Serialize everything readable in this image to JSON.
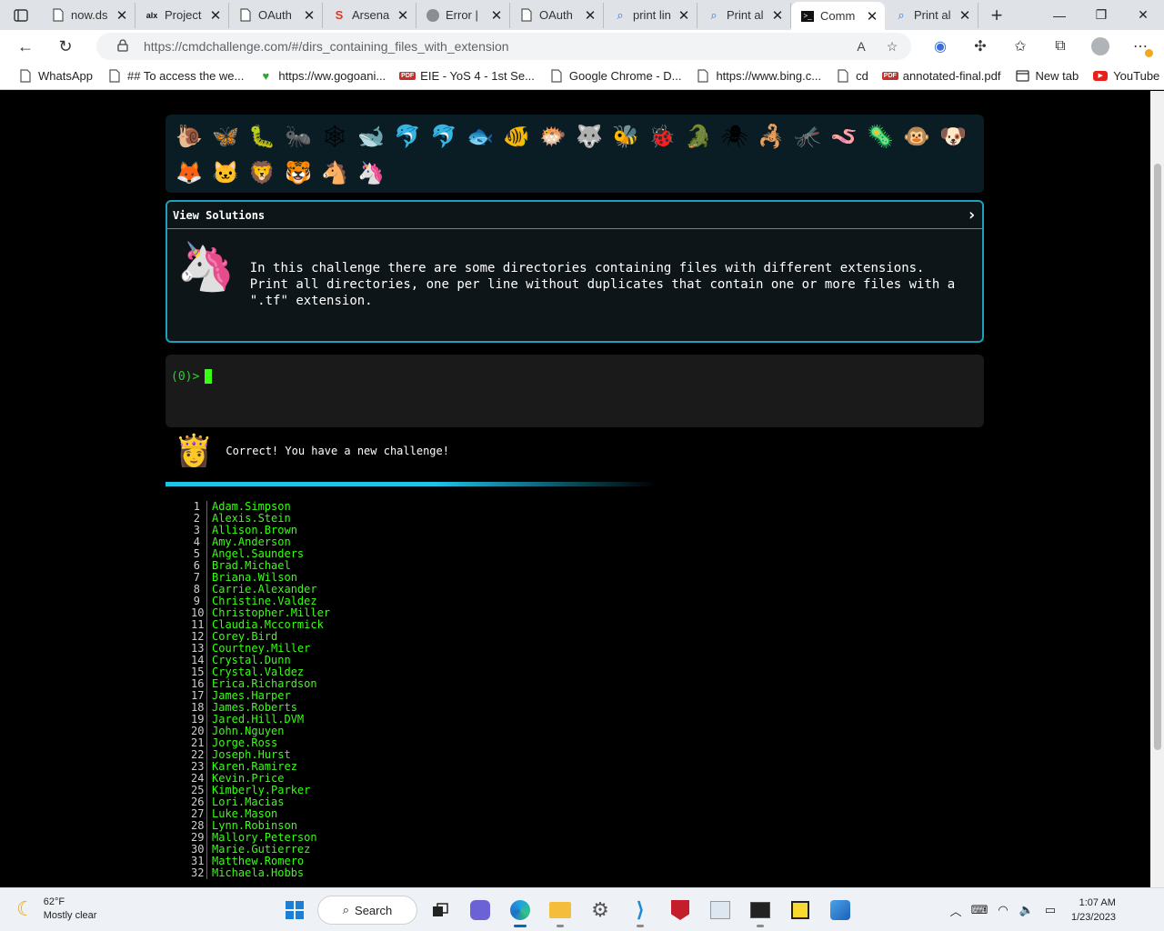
{
  "browser": {
    "tabs": [
      {
        "label": "now.ds",
        "icon": "document-icon"
      },
      {
        "label": "Project",
        "icon": "alx-icon"
      },
      {
        "label": "OAuth",
        "icon": "document-icon"
      },
      {
        "label": "Arsena",
        "icon": "arsenal-icon"
      },
      {
        "label": "Error |",
        "icon": "error-icon"
      },
      {
        "label": "OAuth",
        "icon": "document-icon"
      },
      {
        "label": "print lin",
        "icon": "search-icon"
      },
      {
        "label": "Print al",
        "icon": "search-icon"
      },
      {
        "label": "Comm",
        "icon": "terminal-icon",
        "active": true
      },
      {
        "label": "Print al",
        "icon": "search-icon"
      }
    ],
    "url": "https://cmdchallenge.com/#/dirs_containing_files_with_extension",
    "bookmarks": [
      {
        "label": "WhatsApp",
        "icon": "document-icon"
      },
      {
        "label": "## To access the we...",
        "icon": "document-icon"
      },
      {
        "label": "https://ww.gogoani...",
        "icon": "gogoanime-icon"
      },
      {
        "label": "EIE - YoS 4 - 1st Se...",
        "icon": "pdf-icon"
      },
      {
        "label": "Google Chrome - D...",
        "icon": "document-icon"
      },
      {
        "label": "https://www.bing.c...",
        "icon": "document-icon"
      },
      {
        "label": "cd",
        "icon": "document-icon"
      },
      {
        "label": "annotated-final.pdf",
        "icon": "pdf-icon"
      },
      {
        "label": "New tab",
        "icon": "newtab-icon"
      },
      {
        "label": "YouTube",
        "icon": "youtube-icon"
      }
    ],
    "pdf_badge": "PDF"
  },
  "page": {
    "emojis": [
      "🐌",
      "🦋",
      "🐛",
      "🐜",
      "🕸",
      "🐋",
      "🐬",
      "🐬",
      "🐟",
      "🐠",
      "🐡",
      "🐺",
      "🐝",
      "🐞",
      "🐊",
      "🕷",
      "🦂",
      "🦟",
      "🪱",
      "🦠",
      "🐵",
      "🐶",
      "🦊",
      "🐱",
      "🦁",
      "🐯",
      "🐴",
      "🦄"
    ],
    "view_solutions": "View Solutions",
    "challenge_text": "In this challenge there are some directories containing files with different extensions.\nPrint all directories, one per line without duplicates that contain one or more files with a\n\".tf\" extension.",
    "prompt": "(0)>",
    "correct_message": "Correct! You have a new challenge!",
    "output_lines": [
      "Adam.Simpson",
      "Alexis.Stein",
      "Allison.Brown",
      "Amy.Anderson",
      "Angel.Saunders",
      "Brad.Michael",
      "Briana.Wilson",
      "Carrie.Alexander",
      "Christine.Valdez",
      "Christopher.Miller",
      "Claudia.Mccormick",
      "Corey.Bird",
      "Courtney.Miller",
      "Crystal.Dunn",
      "Crystal.Valdez",
      "Erica.Richardson",
      "James.Harper",
      "James.Roberts",
      "Jared.Hill.DVM",
      "John.Nguyen",
      "Jorge.Ross",
      "Joseph.Hurst",
      "Karen.Ramirez",
      "Kevin.Price",
      "Kimberly.Parker",
      "Lori.Macias",
      "Luke.Mason",
      "Lynn.Robinson",
      "Mallory.Peterson",
      "Marie.Gutierrez",
      "Matthew.Romero",
      "Michaela.Hobbs"
    ],
    "output_line_numbers": [
      "1",
      "2",
      "3",
      "4",
      "5",
      "6",
      "7",
      "8",
      "9",
      "10",
      "11",
      "12",
      "13",
      "14",
      "15",
      "16",
      "17",
      "18",
      "19",
      "20",
      "21",
      "22",
      "23",
      "24",
      "25",
      "26",
      "27",
      "28",
      "29",
      "30",
      "31",
      "32"
    ]
  },
  "taskbar": {
    "temperature": "62°F",
    "weather": "Mostly clear",
    "search_label": "Search",
    "time": "1:07 AM",
    "date": "1/23/2023"
  },
  "colors": {
    "terminal_green": "#39ff14",
    "accent_cyan": "#1e9fbd",
    "page_bg": "#000000"
  }
}
